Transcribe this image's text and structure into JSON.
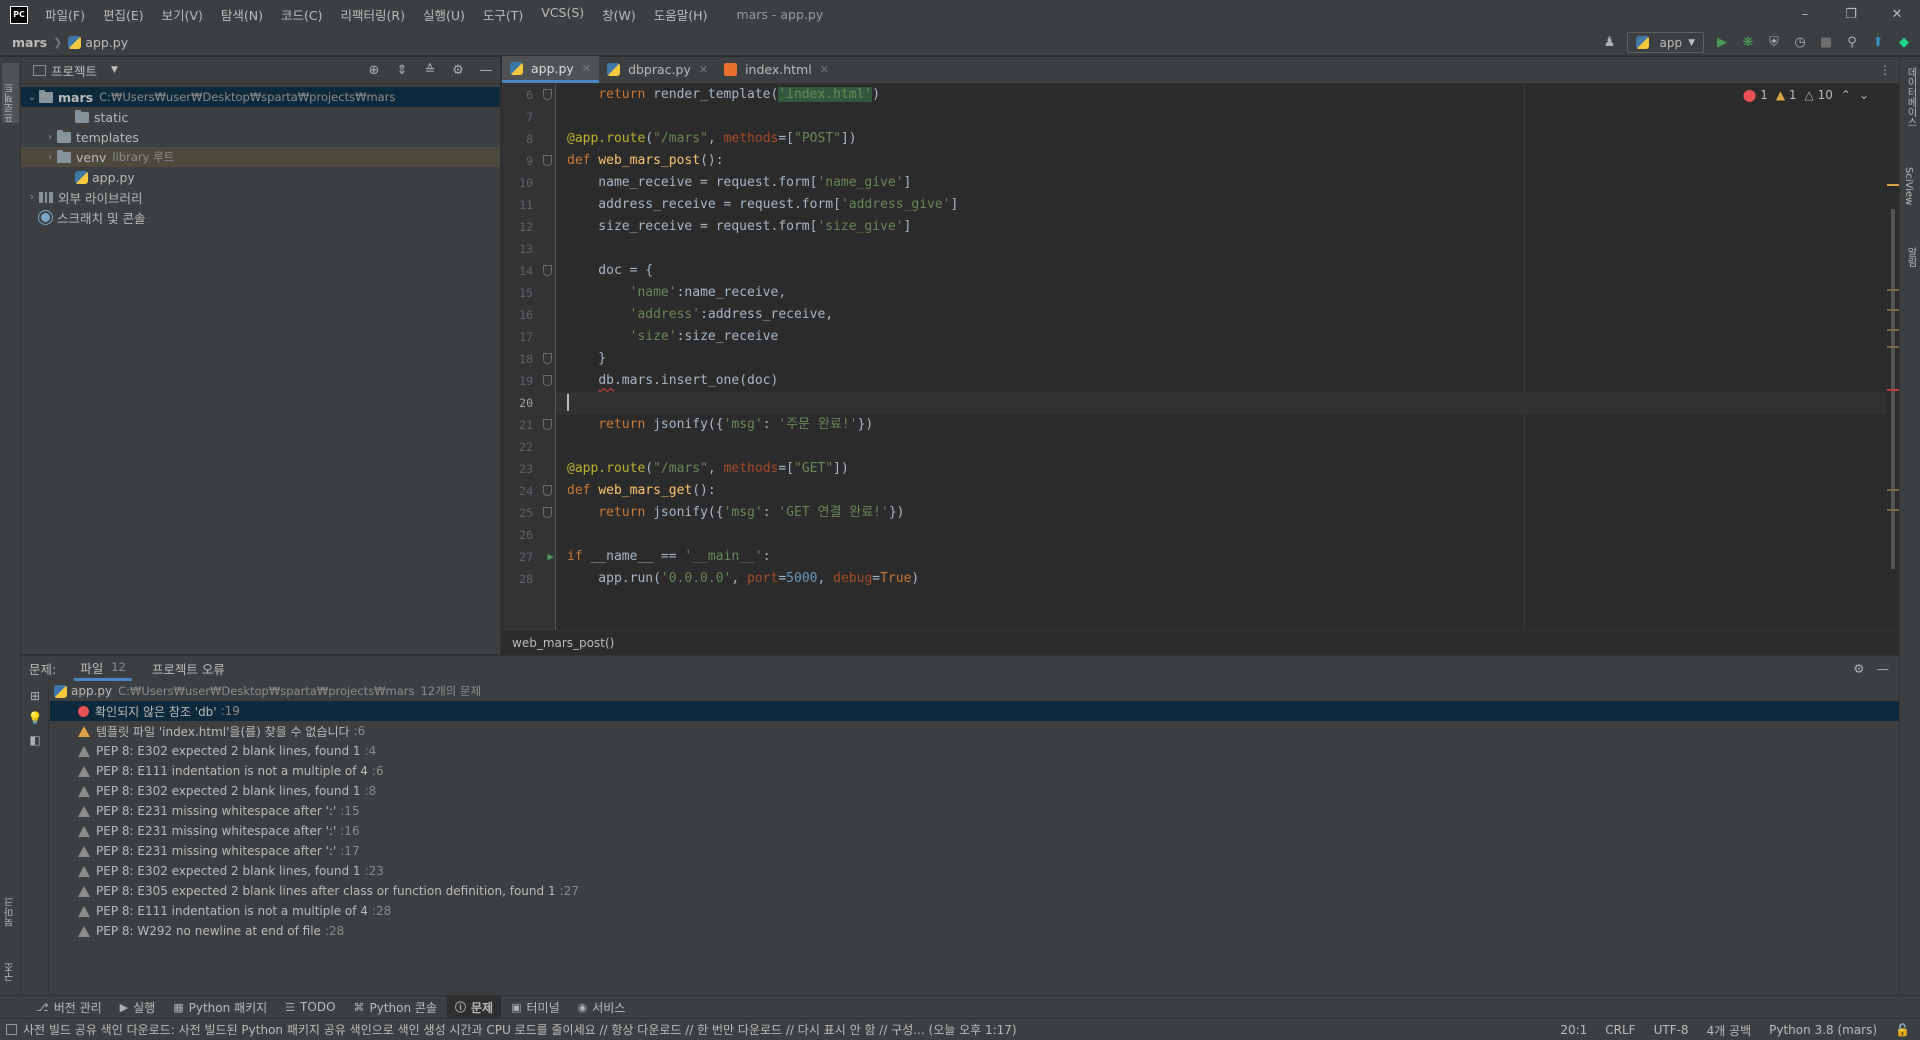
{
  "app": {
    "logo": "PC",
    "window_title": "mars - app.py",
    "menu": [
      "파일(F)",
      "편집(E)",
      "보기(V)",
      "탐색(N)",
      "코드(C)",
      "리팩터링(R)",
      "실행(U)",
      "도구(T)",
      "VCS(S)",
      "창(W)",
      "도움말(H)"
    ]
  },
  "navbar": {
    "breadcrumbs": [
      "mars",
      "app.py"
    ],
    "run_config": "app"
  },
  "project_panel": {
    "title": "프로젝트",
    "tree": [
      {
        "label": "mars",
        "hint": "C:₩Users₩user₩Desktop₩sparta₩projects₩mars",
        "depth": 0,
        "type": "folder",
        "expanded": true,
        "selected": true
      },
      {
        "label": "static",
        "hint": "",
        "depth": 2,
        "type": "folder",
        "expanded": false
      },
      {
        "label": "templates",
        "hint": "",
        "depth": 1,
        "type": "folder",
        "expanded": false
      },
      {
        "label": "venv",
        "hint": "library 루트",
        "depth": 1,
        "type": "folder",
        "expanded": false,
        "excluded": true
      },
      {
        "label": "app.py",
        "hint": "",
        "depth": 2,
        "type": "python"
      },
      {
        "label": "외부 라이브러리",
        "hint": "",
        "depth": 0,
        "type": "library"
      },
      {
        "label": "스크래치 및 콘솔",
        "hint": "",
        "depth": 0,
        "type": "scratch"
      }
    ]
  },
  "left_stripe": {
    "project": "프로젝트",
    "bookmarks": "북마크",
    "structure": "구조"
  },
  "right_stripe": {
    "database": "데이터베이스",
    "sciview": "SciView",
    "notifications": "알림"
  },
  "editor": {
    "tabs": [
      {
        "label": "app.py",
        "icon": "python",
        "active": true
      },
      {
        "label": "dbprac.py",
        "icon": "python",
        "active": false
      },
      {
        "label": "index.html",
        "icon": "html",
        "active": false
      }
    ],
    "inspections": {
      "errors": "1",
      "warnings": "1",
      "weak_warnings": "10"
    },
    "first_line": 6,
    "current_line": 20,
    "lines": [
      {
        "n": "6",
        "text": "    return render_template('index.html')"
      },
      {
        "n": "7",
        "text": ""
      },
      {
        "n": "8",
        "text": "@app.route(\"/mars\", methods=[\"POST\"])"
      },
      {
        "n": "9",
        "text": "def web_mars_post():"
      },
      {
        "n": "10",
        "text": "    name_receive = request.form['name_give']"
      },
      {
        "n": "11",
        "text": "    address_receive = request.form['address_give']"
      },
      {
        "n": "12",
        "text": "    size_receive = request.form['size_give']"
      },
      {
        "n": "13",
        "text": ""
      },
      {
        "n": "14",
        "text": "    doc = {"
      },
      {
        "n": "15",
        "text": "        'name':name_receive,"
      },
      {
        "n": "16",
        "text": "        'address':address_receive,"
      },
      {
        "n": "17",
        "text": "        'size':size_receive"
      },
      {
        "n": "18",
        "text": "    }"
      },
      {
        "n": "19",
        "text": "    db.mars.insert_one(doc)"
      },
      {
        "n": "20",
        "text": ""
      },
      {
        "n": "21",
        "text": "    return jsonify({'msg': '주문 완료!'})"
      },
      {
        "n": "22",
        "text": ""
      },
      {
        "n": "23",
        "text": "@app.route(\"/mars\", methods=[\"GET\"])"
      },
      {
        "n": "24",
        "text": "def web_mars_get():"
      },
      {
        "n": "25",
        "text": "    return jsonify({'msg': 'GET 연결 완료!'})"
      },
      {
        "n": "26",
        "text": ""
      },
      {
        "n": "27",
        "text": "if __name__ == '__main__':"
      },
      {
        "n": "28",
        "text": "    app.run('0.0.0.0', port=5000, debug=True)"
      }
    ],
    "breadcrumb": "web_mars_post()"
  },
  "problems": {
    "label": "문제:",
    "tabs": [
      {
        "label": "파일",
        "count": "12",
        "active": true
      },
      {
        "label": "프로젝트 오류",
        "count": "",
        "active": false
      }
    ],
    "file_row": {
      "file": "app.py",
      "path": "C:₩Users₩user₩Desktop₩sparta₩projects₩mars",
      "summary": "12개의 문제"
    },
    "items": [
      {
        "severity": "error",
        "message": "확인되지 않은 참조 'db'",
        "line": ":19"
      },
      {
        "severity": "warning",
        "message": "템플릿 파일 'index.html'을(를) 찾을 수 없습니다",
        "line": ":6"
      },
      {
        "severity": "weak",
        "message": "PEP 8: E302 expected 2 blank lines, found 1",
        "line": ":4"
      },
      {
        "severity": "weak",
        "message": "PEP 8: E111 indentation is not a multiple of 4",
        "line": ":6"
      },
      {
        "severity": "weak",
        "message": "PEP 8: E302 expected 2 blank lines, found 1",
        "line": ":8"
      },
      {
        "severity": "weak",
        "message": "PEP 8: E231 missing whitespace after ':'",
        "line": ":15"
      },
      {
        "severity": "weak",
        "message": "PEP 8: E231 missing whitespace after ':'",
        "line": ":16"
      },
      {
        "severity": "weak",
        "message": "PEP 8: E231 missing whitespace after ':'",
        "line": ":17"
      },
      {
        "severity": "weak",
        "message": "PEP 8: E302 expected 2 blank lines, found 1",
        "line": ":23"
      },
      {
        "severity": "weak",
        "message": "PEP 8: E305 expected 2 blank lines after class or function definition, found 1",
        "line": ":27"
      },
      {
        "severity": "weak",
        "message": "PEP 8: E111 indentation is not a multiple of 4",
        "line": ":28"
      },
      {
        "severity": "weak",
        "message": "PEP 8: W292 no newline at end of file",
        "line": ":28"
      }
    ]
  },
  "tool_windows": [
    {
      "label": "버전 관리",
      "icon": "vcs",
      "active": false
    },
    {
      "label": "실행",
      "icon": "run",
      "active": false
    },
    {
      "label": "Python 패키지",
      "icon": "packages",
      "active": false
    },
    {
      "label": "TODO",
      "icon": "todo",
      "active": false
    },
    {
      "label": "Python 콘솔",
      "icon": "console",
      "active": false
    },
    {
      "label": "문제",
      "icon": "problems",
      "active": true
    },
    {
      "label": "터미널",
      "icon": "terminal",
      "active": false
    },
    {
      "label": "서비스",
      "icon": "services",
      "active": false
    }
  ],
  "status": {
    "message": "사전 빌드 공유 색인 다운로드: 사전 빌드된 Python 패키지 공유 색인으로 색인 생성 시간과 CPU 로드를 줄이세요 // 항상 다운로드 // 한 번만 다운로드 // 다시 표시 안 함 // 구성... (오늘 오후 1:17)",
    "position": "20:1",
    "line_sep": "CRLF",
    "encoding": "UTF-8",
    "indent": "4개 공백",
    "interpreter": "Python 3.8 (mars)"
  },
  "colors": {
    "keyword": "#cc7832",
    "string": "#6a8759",
    "function": "#ffc66d",
    "decorator": "#bbb529",
    "number": "#6897bb",
    "error": "#e75050",
    "warning": "#d9a343",
    "accent": "#4a88c7"
  }
}
